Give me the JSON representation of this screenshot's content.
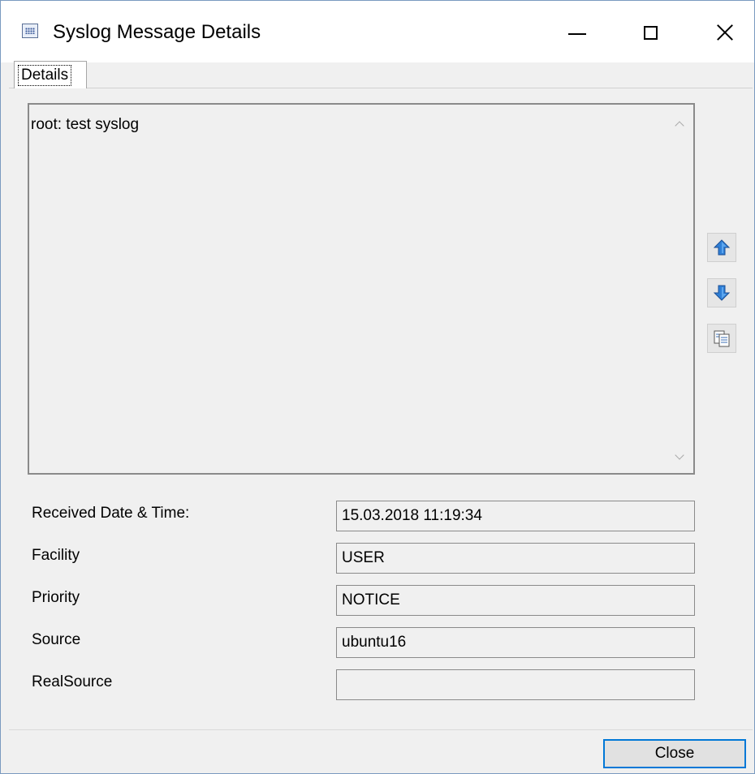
{
  "window": {
    "title": "Syslog Message Details",
    "icon": "window-app-icon"
  },
  "titlebar_buttons": {
    "minimize_icon": "minimize-icon",
    "maximize_icon": "maximize-icon",
    "close_icon": "close-icon"
  },
  "tabs": [
    {
      "label": "Details",
      "selected": true
    }
  ],
  "message": {
    "text": "root: test syslog"
  },
  "side_buttons": [
    {
      "icon": "arrow-up-icon"
    },
    {
      "icon": "arrow-down-icon"
    },
    {
      "icon": "copy-icon"
    }
  ],
  "fields": [
    {
      "label": "Received Date & Time:",
      "value": "15.03.2018 11:19:34"
    },
    {
      "label": "Facility",
      "value": "USER"
    },
    {
      "label": "Priority",
      "value": "NOTICE"
    },
    {
      "label": "Source",
      "value": "ubuntu16"
    },
    {
      "label": "RealSource",
      "value": ""
    }
  ],
  "footer": {
    "close_label": "Close"
  },
  "colors": {
    "accent": "#0078d7",
    "arrow_blue": "#2f7fd6"
  }
}
